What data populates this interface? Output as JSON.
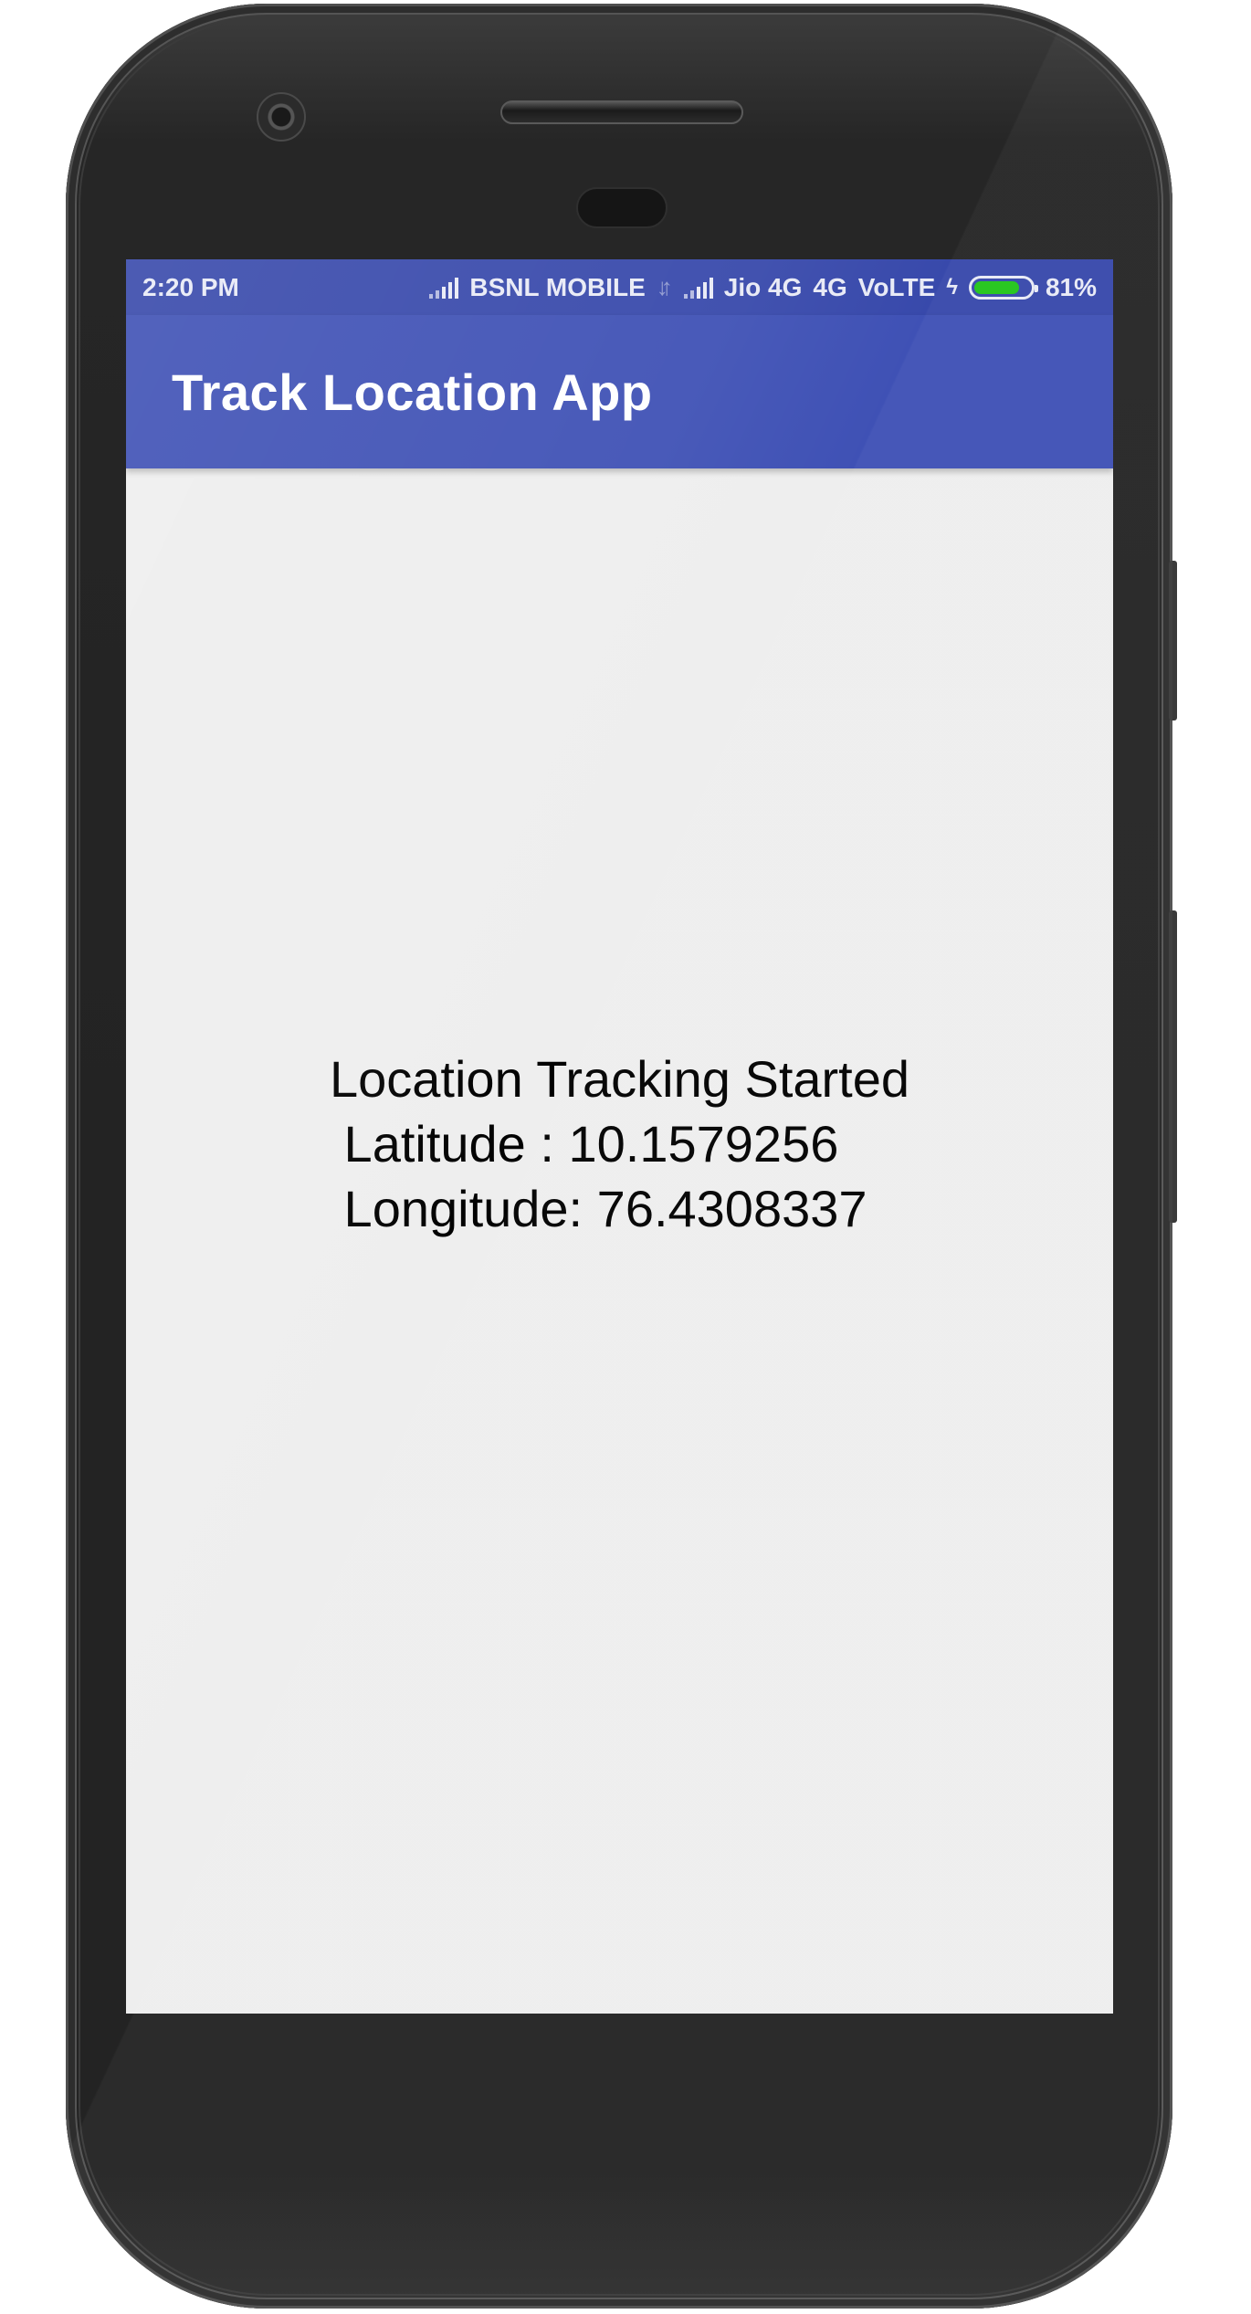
{
  "status_bar": {
    "time": "2:20 PM",
    "carrier1": "BSNL MOBILE",
    "carrier2": "Jio 4G",
    "network": "4G",
    "volte": "VoLTE",
    "battery_percent": "81%",
    "battery_level": 0.81,
    "icons": [
      "signal-icon",
      "data-arrows-icon",
      "signal-icon",
      "charging-bolt-icon",
      "battery-icon"
    ]
  },
  "app_bar": {
    "title": "Track Location App"
  },
  "location": {
    "status_line": "Location Tracking Started",
    "latitude_line": " Latitude : 10.1579256",
    "longitude_line": " Longitude: 76.4308337"
  },
  "colors": {
    "primary": "#3f51b5",
    "primary_dark": "#3849ab",
    "background": "#eeeeee",
    "battery": "#22c51a"
  }
}
